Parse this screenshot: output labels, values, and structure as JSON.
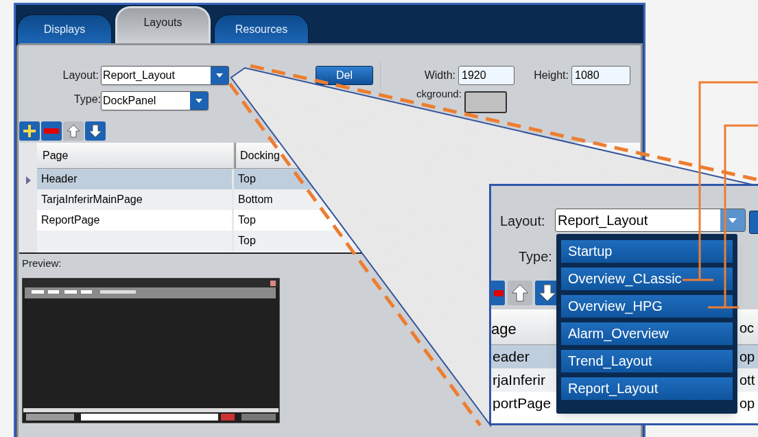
{
  "tabs": [
    {
      "label": "Displays",
      "selected": false
    },
    {
      "label": "Layouts",
      "selected": true
    },
    {
      "label": "Resources",
      "selected": false
    }
  ],
  "layout_form": {
    "layout_label": "Layout:",
    "layout_value": "Report_Layout",
    "del_button": "Del",
    "type_label": "Type:",
    "type_value": "DockPanel",
    "width_label": "Width:",
    "width_value": "1920",
    "height_label": "Height:",
    "height_value": "1080",
    "background_label": "ckground:"
  },
  "pages_table": {
    "columns": [
      "Page",
      "Docking"
    ],
    "rows": [
      {
        "page": "Header",
        "docking": "Top",
        "selected": true
      },
      {
        "page": "TarjaInferirMainPage",
        "docking": "Bottom",
        "selected": false
      },
      {
        "page": "ReportPage",
        "docking": "Top",
        "selected": false
      },
      {
        "docking": "Top",
        "selected": false
      }
    ]
  },
  "preview_label": "Preview:",
  "magnified_inset": {
    "layout_label": "Layout:",
    "layout_value": "Report_Layout",
    "type_label": "Type:",
    "page_column": "age",
    "docking_column": "oc",
    "rows": [
      {
        "page": "eader",
        "docking": "op",
        "selected": true
      },
      {
        "page": "rjaInferir",
        "docking": "ott",
        "selected": false
      },
      {
        "page": "portPage",
        "docking": "op",
        "selected": false
      }
    ],
    "dropdown_items": [
      {
        "label": "Startup",
        "callout": false
      },
      {
        "label": "Overview_CLassic",
        "callout": true
      },
      {
        "label": "Overview_HPG",
        "callout": true
      },
      {
        "label": "Alarm_Overview",
        "callout": false
      },
      {
        "label": "Trend_Layout",
        "callout": false
      },
      {
        "label": "Report_Layout",
        "callout": false
      }
    ]
  }
}
